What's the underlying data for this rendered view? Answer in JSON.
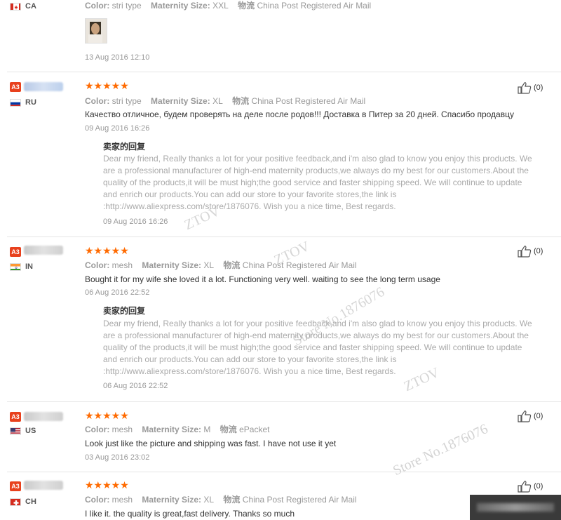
{
  "labels": {
    "color": "Color:",
    "size": "Maternity Size:",
    "logistics": "物流",
    "reply_title": "卖家的回复"
  },
  "reviews": [
    {
      "country": "CA",
      "stars": "★★★★★",
      "color_value": "stri type",
      "size_value": "XXL",
      "shipping": "China Post Registered Air Mail",
      "feedback": "",
      "date": "13 Aug 2016 12:10",
      "has_photo": true
    },
    {
      "badge": "A3",
      "country": "RU",
      "stars": "★★★★★",
      "color_value": "stri type",
      "size_value": "XL",
      "shipping": "China Post Registered Air Mail",
      "feedback": "Качество отличное, будем проверять на деле после родов!!! Доставка в Питер за 20 дней. Спасибо продавцу",
      "date": "09 Aug 2016 16:26",
      "reply_text": "Dear my friend, Really thanks a lot for your positive feedback,and i'm also glad to know you enjoy this products. We are a professional manufacturer of high-end maternity products,we always do my best for our customers.About the quality of the products,it will be must high;the good service and faster shipping speed. We will continue to update and enrich our products.You can add our store to your favorite stores,the link is :http://www.aliexpress.com/store/1876076. Wish you a nice time, Best regards.",
      "reply_date": "09 Aug 2016 16:26",
      "helpful": "(0)"
    },
    {
      "badge": "A3",
      "country": "IN",
      "stars": "★★★★★",
      "color_value": "mesh",
      "size_value": "XL",
      "shipping": "China Post Registered Air Mail",
      "feedback": "Bought it for my wife she loved it a lot. Functioning very well. waiting to see the long term usage",
      "date": "06 Aug 2016 22:52",
      "reply_text": "Dear my friend, Really thanks a lot for your positive feedback,and i'm also glad to know you enjoy this products. We are a professional manufacturer of high-end maternity products,we always do my best for our customers.About the quality of the products,it will be must high;the good service and faster shipping speed. We will continue to update and enrich our products.You can add our store to your favorite stores,the link is :http://www.aliexpress.com/store/1876076. Wish you a nice time, Best regards.",
      "reply_date": "06 Aug 2016 22:52",
      "helpful": "(0)"
    },
    {
      "badge": "A3",
      "country": "US",
      "stars": "★★★★★",
      "color_value": "mesh",
      "size_value": "M",
      "shipping": "ePacket",
      "feedback": "Look just like the picture and shipping was fast. I have not use it yet",
      "date": "03 Aug 2016 23:02",
      "helpful": "(0)"
    },
    {
      "badge": "A3",
      "country": "CH",
      "stars": "★★★★★",
      "color_value": "mesh",
      "size_value": "XL",
      "shipping": "China Post Registered Air Mail",
      "feedback": "I like it. the quality is great,fast delivery. Thanks so much",
      "helpful": "(0)"
    }
  ],
  "watermarks": [
    "ZTOV",
    "ZTOV",
    "Store No.1876076",
    "ZTOV",
    "Store No.1876076"
  ],
  "colors": {
    "stars": "#ff6a00",
    "badge": "#e8411d",
    "muted": "#999999"
  }
}
